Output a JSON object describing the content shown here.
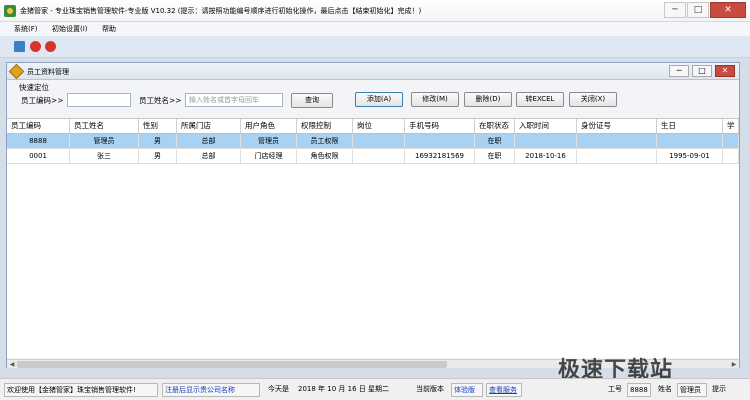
{
  "window": {
    "title": "金猪管家 - 专业珠宝销售管理软件-专业版 V10.32 (提示：请按照功能编号顺序进行初始化操作，最后点击【结束初始化】完成！)",
    "min_label": "─",
    "max_label": "□",
    "close_label": "✕"
  },
  "menu": [
    "系统(F)",
    "初始设置(I)",
    "帮助"
  ],
  "child_window": {
    "title": "员工资料管理",
    "min_label": "─",
    "max_label": "□",
    "close_label": "✕"
  },
  "search": {
    "section_label": "快速定位",
    "code_label": "员工编码>>",
    "code_value": "",
    "name_label": "员工姓名>>",
    "name_placeholder": "输入姓名或首字母回车",
    "query_button": "查询"
  },
  "actions": {
    "add": "添加(A)",
    "edit": "修改(M)",
    "delete": "删除(D)",
    "excel": "转EXCEL",
    "close": "关闭(X)"
  },
  "table": {
    "columns": [
      "员工编码",
      "员工姓名",
      "性别",
      "所属门店",
      "用户角色",
      "权限控制",
      "岗位",
      "手机号码",
      "在职状态",
      "入职时间",
      "身份证号",
      "生日",
      "学"
    ],
    "rows": [
      [
        "8888",
        "管理员",
        "男",
        "总部",
        "管理员",
        "员工权限",
        "",
        "",
        "在职",
        "",
        "",
        "",
        ""
      ],
      [
        "0001",
        "张三",
        "男",
        "总部",
        "门店经理",
        "角色权限",
        "",
        "16932181569",
        "在职",
        "2018-10-16",
        "",
        "1995-09-01",
        ""
      ]
    ],
    "selected_row": 0
  },
  "status": {
    "welcome": "欢迎使用【金猪管家】珠宝销售管理软件!",
    "reg": "注册后显示贵公司名称",
    "today_label": "今天是",
    "today_value": "2018 年 10 月 16 日  星期二",
    "version_label": "当前版本",
    "version_value": "体验版",
    "service": "查看服务",
    "id_label": "工号",
    "id_value": "8888",
    "name_label": "姓名",
    "name_value": "管理员",
    "extra": "提示"
  },
  "watermark": "极速下载站",
  "colors": {
    "selected_row": "#a8d2f4",
    "link": "#1a3fb8"
  }
}
